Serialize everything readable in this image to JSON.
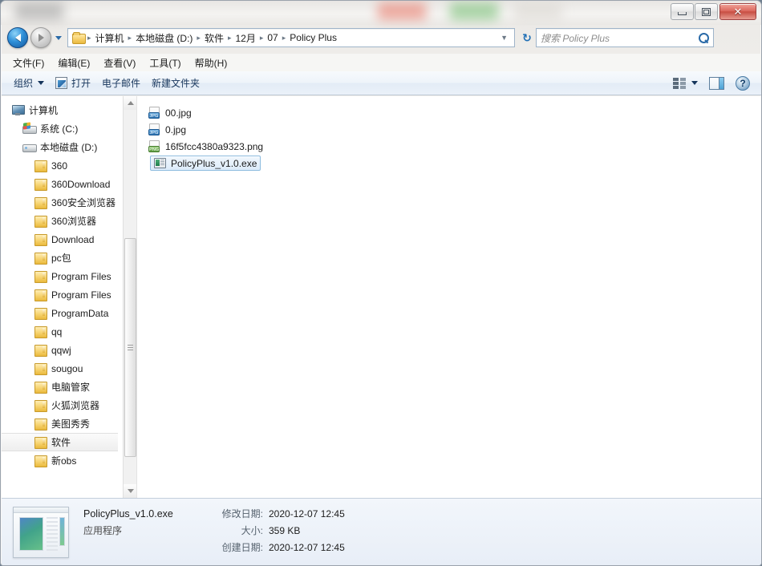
{
  "window": {
    "controls": {
      "minimize": "–",
      "maximize": "□",
      "close": "✕"
    }
  },
  "address": {
    "back_icon": "back-arrow",
    "forward_icon": "forward-arrow",
    "history_icon": "chevron-down",
    "folder_icon": "folder-icon",
    "crumbs": [
      "计算机",
      "本地磁盘 (D:)",
      "软件",
      "12月",
      "07",
      "Policy Plus"
    ],
    "separator": "▸",
    "dropdown_icon": "▼",
    "refresh_icon": "↻"
  },
  "search": {
    "placeholder": "搜索 Policy Plus",
    "icon": "search-icon"
  },
  "menubar": {
    "items": [
      "文件(F)",
      "编辑(E)",
      "查看(V)",
      "工具(T)",
      "帮助(H)"
    ]
  },
  "toolbar": {
    "organize": "组织",
    "open": "打开",
    "email": "电子邮件",
    "new_folder": "新建文件夹",
    "view_icon": "view-options-icon",
    "view_caret": "▼",
    "preview_icon": "preview-pane-icon",
    "help_icon": "?"
  },
  "sidebar": {
    "items": [
      {
        "label": "计算机",
        "icon": "computer-icon",
        "level": 0,
        "selected": false
      },
      {
        "label": "系统 (C:)",
        "icon": "system-drive-icon",
        "level": 1,
        "selected": false
      },
      {
        "label": "本地磁盘 (D:)",
        "icon": "local-disk-icon",
        "level": 1,
        "selected": false
      },
      {
        "label": "360",
        "icon": "folder-icon",
        "level": 2,
        "selected": false
      },
      {
        "label": "360Download",
        "icon": "folder-icon",
        "level": 2,
        "selected": false
      },
      {
        "label": "360安全浏览器",
        "icon": "folder-icon",
        "level": 2,
        "selected": false
      },
      {
        "label": "360浏览器",
        "icon": "folder-icon",
        "level": 2,
        "selected": false
      },
      {
        "label": "Download",
        "icon": "folder-icon",
        "level": 2,
        "selected": false
      },
      {
        "label": "pc包",
        "icon": "folder-icon",
        "level": 2,
        "selected": false
      },
      {
        "label": "Program Files",
        "icon": "folder-icon",
        "level": 2,
        "selected": false
      },
      {
        "label": "Program Files",
        "icon": "folder-icon",
        "level": 2,
        "selected": false
      },
      {
        "label": "ProgramData",
        "icon": "folder-icon",
        "level": 2,
        "selected": false
      },
      {
        "label": "qq",
        "icon": "folder-icon",
        "level": 2,
        "selected": false
      },
      {
        "label": "qqwj",
        "icon": "folder-icon",
        "level": 2,
        "selected": false
      },
      {
        "label": "sougou",
        "icon": "folder-icon",
        "level": 2,
        "selected": false
      },
      {
        "label": "电脑管家",
        "icon": "folder-icon",
        "level": 2,
        "selected": false
      },
      {
        "label": "火狐浏览器",
        "icon": "folder-icon",
        "level": 2,
        "selected": false
      },
      {
        "label": "美图秀秀",
        "icon": "folder-icon",
        "level": 2,
        "selected": false
      },
      {
        "label": "软件",
        "icon": "folder-icon",
        "level": 2,
        "selected": true
      },
      {
        "label": "新obs",
        "icon": "folder-icon",
        "level": 2,
        "selected": false
      }
    ]
  },
  "files": [
    {
      "name": "00.jpg",
      "icon": "jpg-file-icon",
      "badge": "JPG",
      "selected": false
    },
    {
      "name": "0.jpg",
      "icon": "jpg-file-icon",
      "badge": "JPG",
      "selected": false
    },
    {
      "name": "16f5fcc4380a9323.png",
      "icon": "png-file-icon",
      "badge": "PNG",
      "selected": false
    },
    {
      "name": "PolicyPlus_v1.0.exe",
      "icon": "exe-file-icon",
      "badge": "",
      "selected": true
    }
  ],
  "details": {
    "thumbnail_icon": "application-thumbnail",
    "file_name": "PolicyPlus_v1.0.exe",
    "file_type": "应用程序",
    "fields": [
      {
        "label": "修改日期:",
        "value": "2020-12-07 12:45"
      },
      {
        "label": "大小:",
        "value": "359 KB"
      },
      {
        "label": "创建日期:",
        "value": "2020-12-07 12:45"
      }
    ]
  }
}
